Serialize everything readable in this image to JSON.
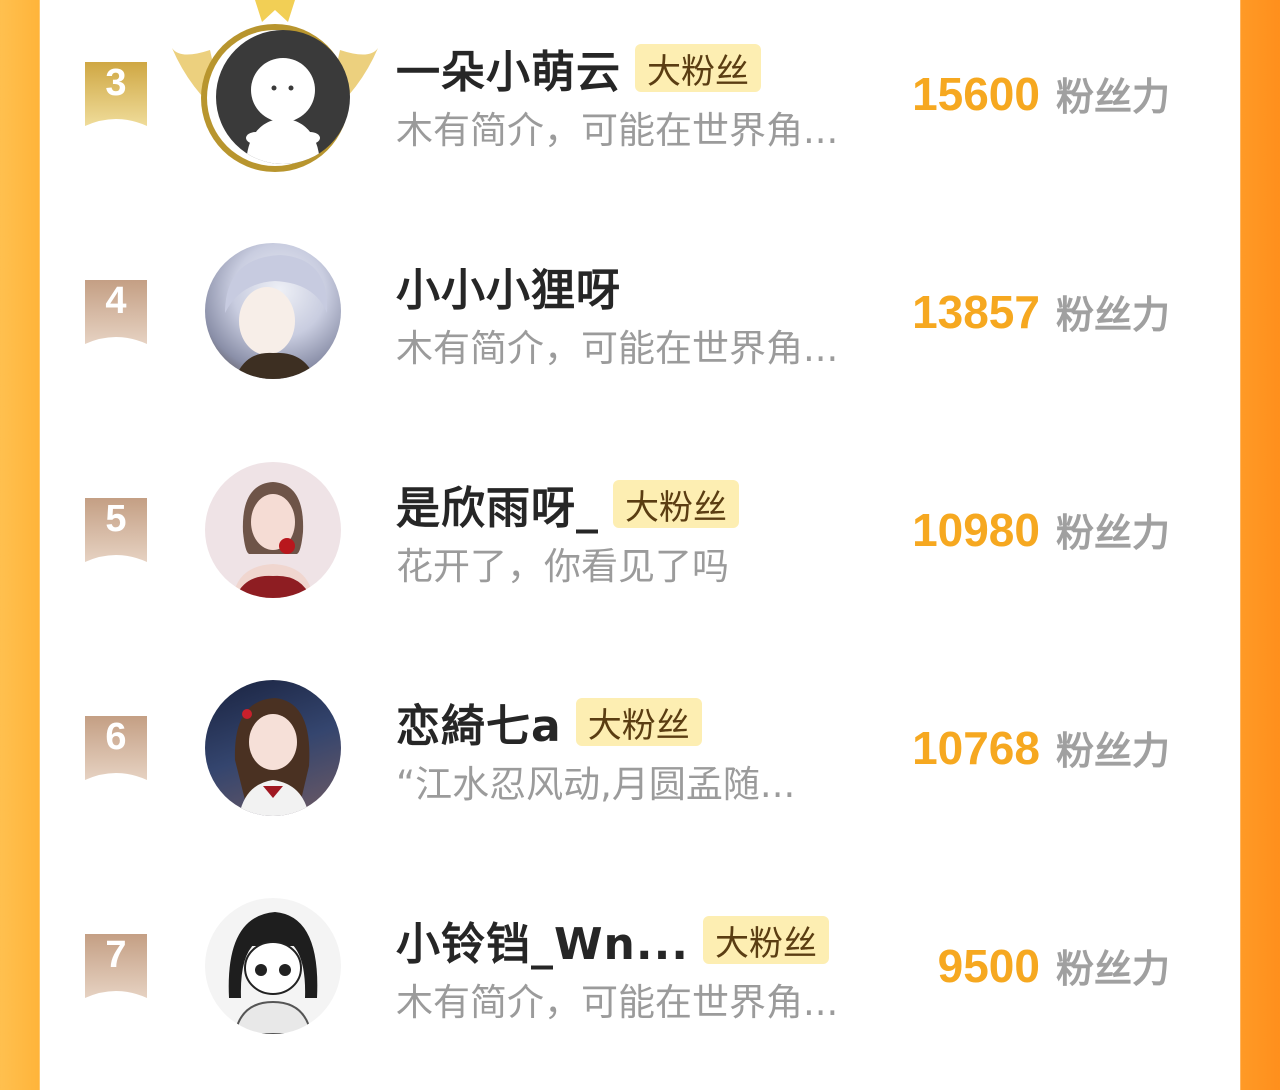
{
  "badge_label": "大粉丝",
  "score_unit": "粉丝力",
  "colors": {
    "accent": "#f6a820",
    "badge_bg": "#fdeeb2",
    "rank_gold": "#d4ad4a",
    "rank_tan": "#c8a48a"
  },
  "users": [
    {
      "rank": "3",
      "name": "一朵小萌云",
      "has_badge": true,
      "bio": "木有简介，可能在世界角...",
      "score": "15600",
      "crown": true
    },
    {
      "rank": "4",
      "name": "小小小狸呀",
      "has_badge": false,
      "bio": "木有简介，可能在世界角...",
      "score": "13857",
      "crown": false
    },
    {
      "rank": "5",
      "name": "是欣雨呀_",
      "has_badge": true,
      "bio": "花开了，你看见了吗",
      "score": "10980",
      "crown": false
    },
    {
      "rank": "6",
      "name": "恋綺七a",
      "has_badge": true,
      "bio": "“江水忍风动,月圆孟随...",
      "score": "10768",
      "crown": false
    },
    {
      "rank": "7",
      "name": "小铃铛_Wn...",
      "has_badge": true,
      "bio": "木有简介，可能在世界角...",
      "score": "9500",
      "crown": false
    }
  ]
}
